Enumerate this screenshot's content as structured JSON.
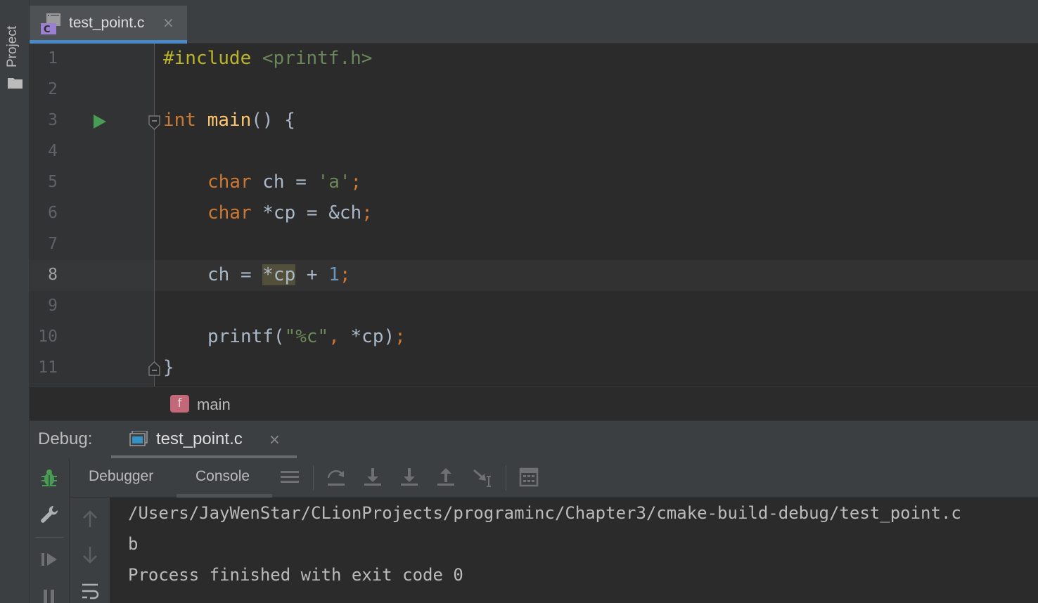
{
  "sidebar": {
    "project_label": "Project"
  },
  "editor": {
    "tab_title": "test_point.c",
    "tab_close": "×",
    "line_numbers": [
      "1",
      "2",
      "3",
      "4",
      "5",
      "6",
      "7",
      "8",
      "9",
      "10",
      "11"
    ],
    "current_line": "8"
  },
  "code": {
    "l1_directive": "#include",
    "l1_header": "<printf.h>",
    "l3_type": "int",
    "l3_name": "main",
    "l3_rest": "() {",
    "l5_type": "char",
    "l5_mid": " ch = ",
    "l5_char": "'a'",
    "l5_semi": ";",
    "l6_type": "char",
    "l6_mid": " *cp = &ch",
    "l6_semi": ";",
    "l8_start": "ch = ",
    "l8_hl": "*cp",
    "l8_plus": " + ",
    "l8_num": "1",
    "l8_semi": ";",
    "l10_fn": "printf(",
    "l10_str": "\"%c\"",
    "l10_comma": ",",
    "l10_arg": " *cp)",
    "l10_semi": ";",
    "l11_brace": "}"
  },
  "breadcrumb": {
    "icon_letter": "f",
    "text": "main"
  },
  "debug": {
    "title": "Debug:",
    "tab_title": "test_point.c",
    "tab_close": "×",
    "tabs": [
      {
        "label": "Debugger"
      },
      {
        "label": "Console"
      }
    ],
    "active_tab": "Console"
  },
  "console": {
    "lines": [
      "/Users/JayWenStar/CLionProjects/programinc/Chapter3/cmake-build-debug/test_point.c",
      "b",
      "Process finished with exit code 0"
    ]
  },
  "colors": {
    "keyword": "#cc7832",
    "function": "#ffc66d",
    "string": "#6a8759",
    "number": "#6897bb",
    "tab_accent": "#4a88c7",
    "run_green": "#499c54",
    "debug_bug_green": "#499c54"
  },
  "icons": {
    "project_folder": "folder-icon",
    "file": "c-file-icon",
    "run": "run-icon",
    "debug": "bug-icon",
    "settings": "wrench-icon",
    "resume": "resume-icon",
    "pause": "pause-icon",
    "up": "arrow-up-icon",
    "down": "arrow-down-icon",
    "wrap": "soft-wrap-icon"
  }
}
